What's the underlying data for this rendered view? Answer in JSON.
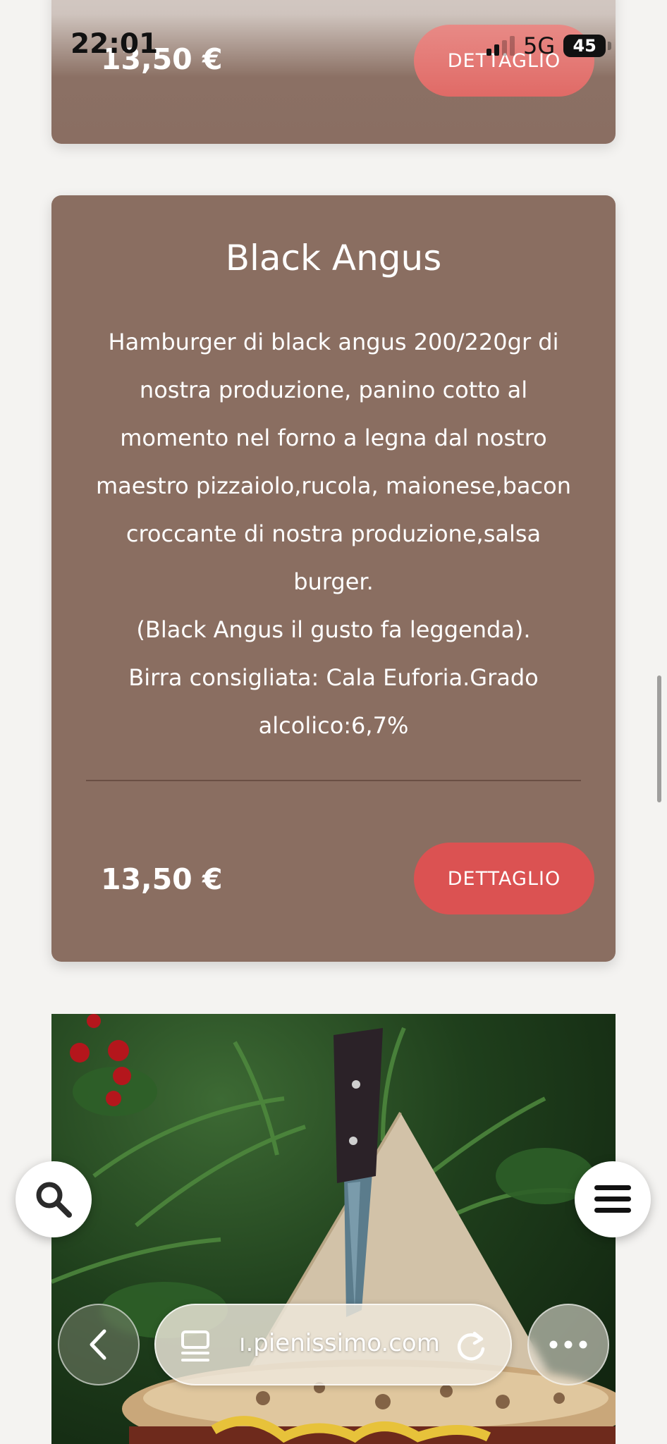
{
  "status_bar": {
    "time": "22:01",
    "network": "5G",
    "battery": "45"
  },
  "previous_card": {
    "price": "13,50 €",
    "button_label": "DETTAGLIO"
  },
  "product_card": {
    "title": "Black Angus",
    "description": "Hamburger di black angus 200/220gr di\nnostra produzione, panino cotto al\nmomento nel forno a legna dal nostro\nmaestro pizzaiolo,rucola, maionese,bacon\ncroccante di nostra produzione,salsa\nburger.\n(Black Angus il gusto fa leggenda).\nBirra consigliata: Cala Euforia.Grado\nalcolico:6,7%",
    "price": "13,50 €",
    "button_label": "DETTAGLIO"
  },
  "floating_buttons": {
    "search_icon": "search-icon",
    "menu_icon": "hamburger-menu-icon"
  },
  "browser": {
    "url": "ı.pienissimo.com",
    "back_icon": "chevron-left-icon",
    "tabs_icon": "tabs-icon",
    "reload_icon": "reload-icon",
    "more_icon": "ellipsis-icon"
  },
  "colors": {
    "card_bg": "#8a6e61",
    "button_bg": "#db5252",
    "page_bg": "#f4f3f1"
  }
}
